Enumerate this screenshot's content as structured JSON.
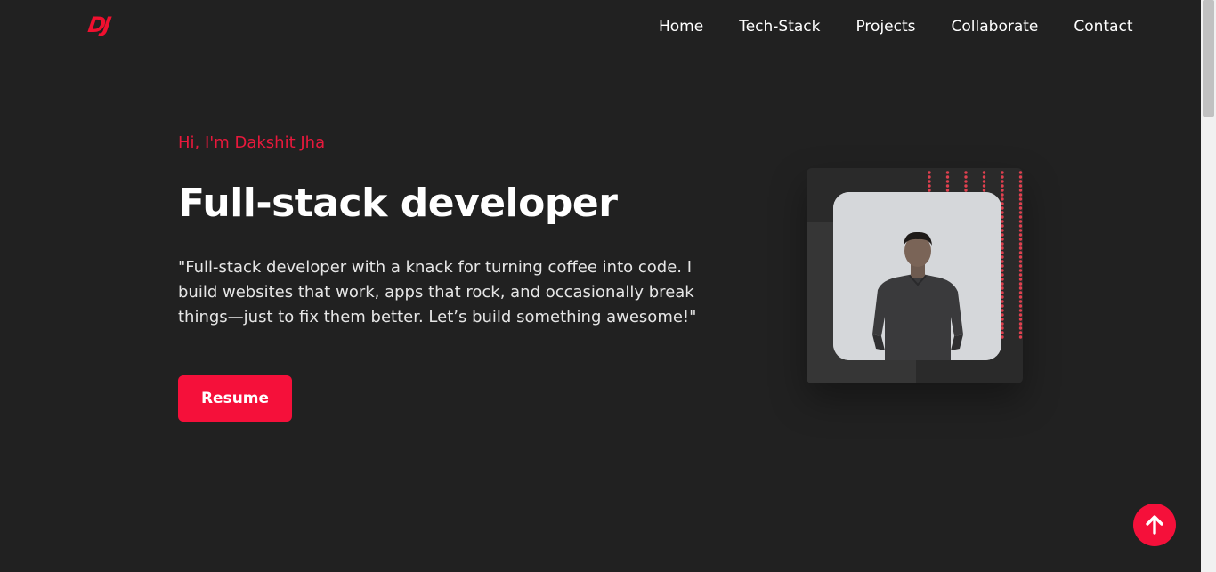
{
  "header": {
    "logo": "DJ",
    "nav": [
      "Home",
      "Tech-Stack",
      "Projects",
      "Collaborate",
      "Contact"
    ]
  },
  "hero": {
    "greeting": "Hi, I'm Dakshit Jha",
    "title": "Full-stack developer",
    "bio": "\"Full-stack developer with a knack for turning coffee into code. I build websites that work, apps that rock, and occasionally break things—just to fix them better. Let’s build something awesome!\"",
    "resume_label": "Resume"
  },
  "icons": {
    "scroll_top": "arrow-up-icon"
  },
  "colors": {
    "accent": "#f5103a",
    "background": "#212121",
    "dot_pattern": "#e0404f"
  }
}
